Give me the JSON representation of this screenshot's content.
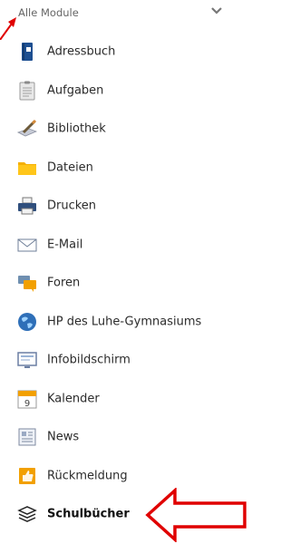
{
  "dropdown": {
    "label": "Alle Module",
    "chevron_icon": "chevron-down-icon"
  },
  "accent_color": "#e00000",
  "items": [
    {
      "label": "Adressbuch",
      "icon": "address-book-icon"
    },
    {
      "label": "Aufgaben",
      "icon": "clipboard-icon"
    },
    {
      "label": "Bibliothek",
      "icon": "library-pencil-icon"
    },
    {
      "label": "Dateien",
      "icon": "folder-icon"
    },
    {
      "label": "Drucken",
      "icon": "printer-icon"
    },
    {
      "label": "E-Mail",
      "icon": "envelope-icon"
    },
    {
      "label": "Foren",
      "icon": "forum-chat-icon"
    },
    {
      "label": "HP des Luhe-Gymnasiums",
      "icon": "globe-icon"
    },
    {
      "label": "Infobildschirm",
      "icon": "monitor-icon"
    },
    {
      "label": "Kalender",
      "icon": "calendar-icon"
    },
    {
      "label": "News",
      "icon": "newspaper-icon"
    },
    {
      "label": "Rückmeldung",
      "icon": "thumbs-up-icon"
    },
    {
      "label": "Schulbücher",
      "icon": "books-icon"
    }
  ]
}
